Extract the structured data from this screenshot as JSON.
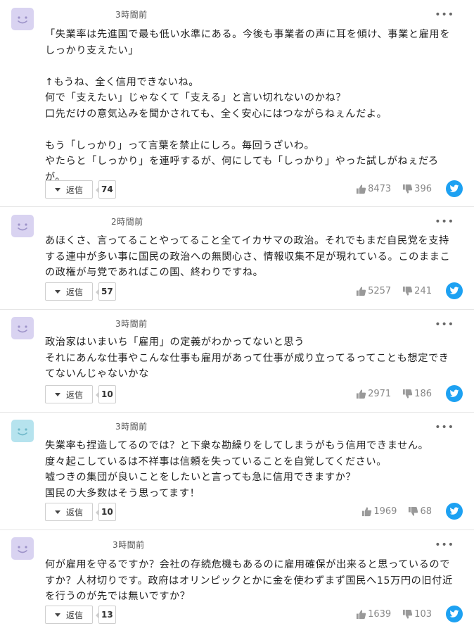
{
  "comments": [
    {
      "avatar_color": "#d9d3f1",
      "time": "3時間前",
      "body": "「失業率は先進国で最も低い水準にある。今後も事業者の声に耳を傾け、事業と雇用を\nしっかり支えたい」\n\n↑もうね、全く信用できないね。\n何で「支えたい」じゃなくて「支える」と言い切れないのかね？\n口先だけの意気込みを聞かされても、全く安心にはつながらねぇんだよ。\n\nもう「しっかり」って言葉を禁止にしろ。毎回うざいわ。\nやたらと「しっかり」を連呼するが、何にしても「しっかり」やった試しがねぇだろ\nが。",
      "reply_label": "返信",
      "reply_count": "74",
      "likes": "8473",
      "dislikes": "396"
    },
    {
      "avatar_color": "#d9d3f1",
      "time": "2時間前",
      "body": "あほくさ、言ってることやってること全てイカサマの政治。それでもまだ自民党を支持\nする連中が多い事に国民の政治への無関心さ、情報収集不足が現れている。このままこ\nの政権が与党であればこの国、終わりですね。",
      "reply_label": "返信",
      "reply_count": "57",
      "likes": "5257",
      "dislikes": "241"
    },
    {
      "avatar_color": "#d9d3f1",
      "time": "3時間前",
      "body": "政治家はいまいち「雇用」の定義がわかってないと思う\nそれにあんな仕事やこんな仕事も雇用があって仕事が成り立ってるってことも想定でき\nてないんじゃないかな",
      "reply_label": "返信",
      "reply_count": "10",
      "likes": "2971",
      "dislikes": "186"
    },
    {
      "avatar_color": "#b6e3ee",
      "time": "3時間前",
      "body": "失業率も捏造してるのでは？と下衆な勘繰りをしてしまうがもう信用できません。\n度々起こしているは不祥事は信頼を失っていることを自覚してください。\n嘘つきの集団が良いことをしたいと言っても急に信用できますか？\n国民の大多数はそう思ってます！",
      "reply_label": "返信",
      "reply_count": "10",
      "likes": "1969",
      "dislikes": "68"
    },
    {
      "avatar_color": "#d9d3f1",
      "time": "3時間前",
      "body": "何が雇用を守るですか？会社の存続危機もあるのに雇用確保が出来ると思っているので\nすか？人材切りです。政府はオリンピックとかに金を使わずまず国民へ15万円の旧付近\nを行うのが先では無いですか？",
      "reply_label": "返信",
      "reply_count": "13",
      "likes": "1639",
      "dislikes": "103"
    }
  ],
  "more_label": "•••",
  "icons": {
    "avatar": "face-avatar-icon",
    "like": "thumbs-up-icon",
    "dislike": "thumbs-down-icon",
    "share": "twitter-bird-icon",
    "reply_toggle": "caret-down-icon",
    "more": "more-options-icon"
  },
  "colors": {
    "twitter": "#1da1f2",
    "vote_gray": "#888888",
    "divider": "#e6e6e6"
  }
}
